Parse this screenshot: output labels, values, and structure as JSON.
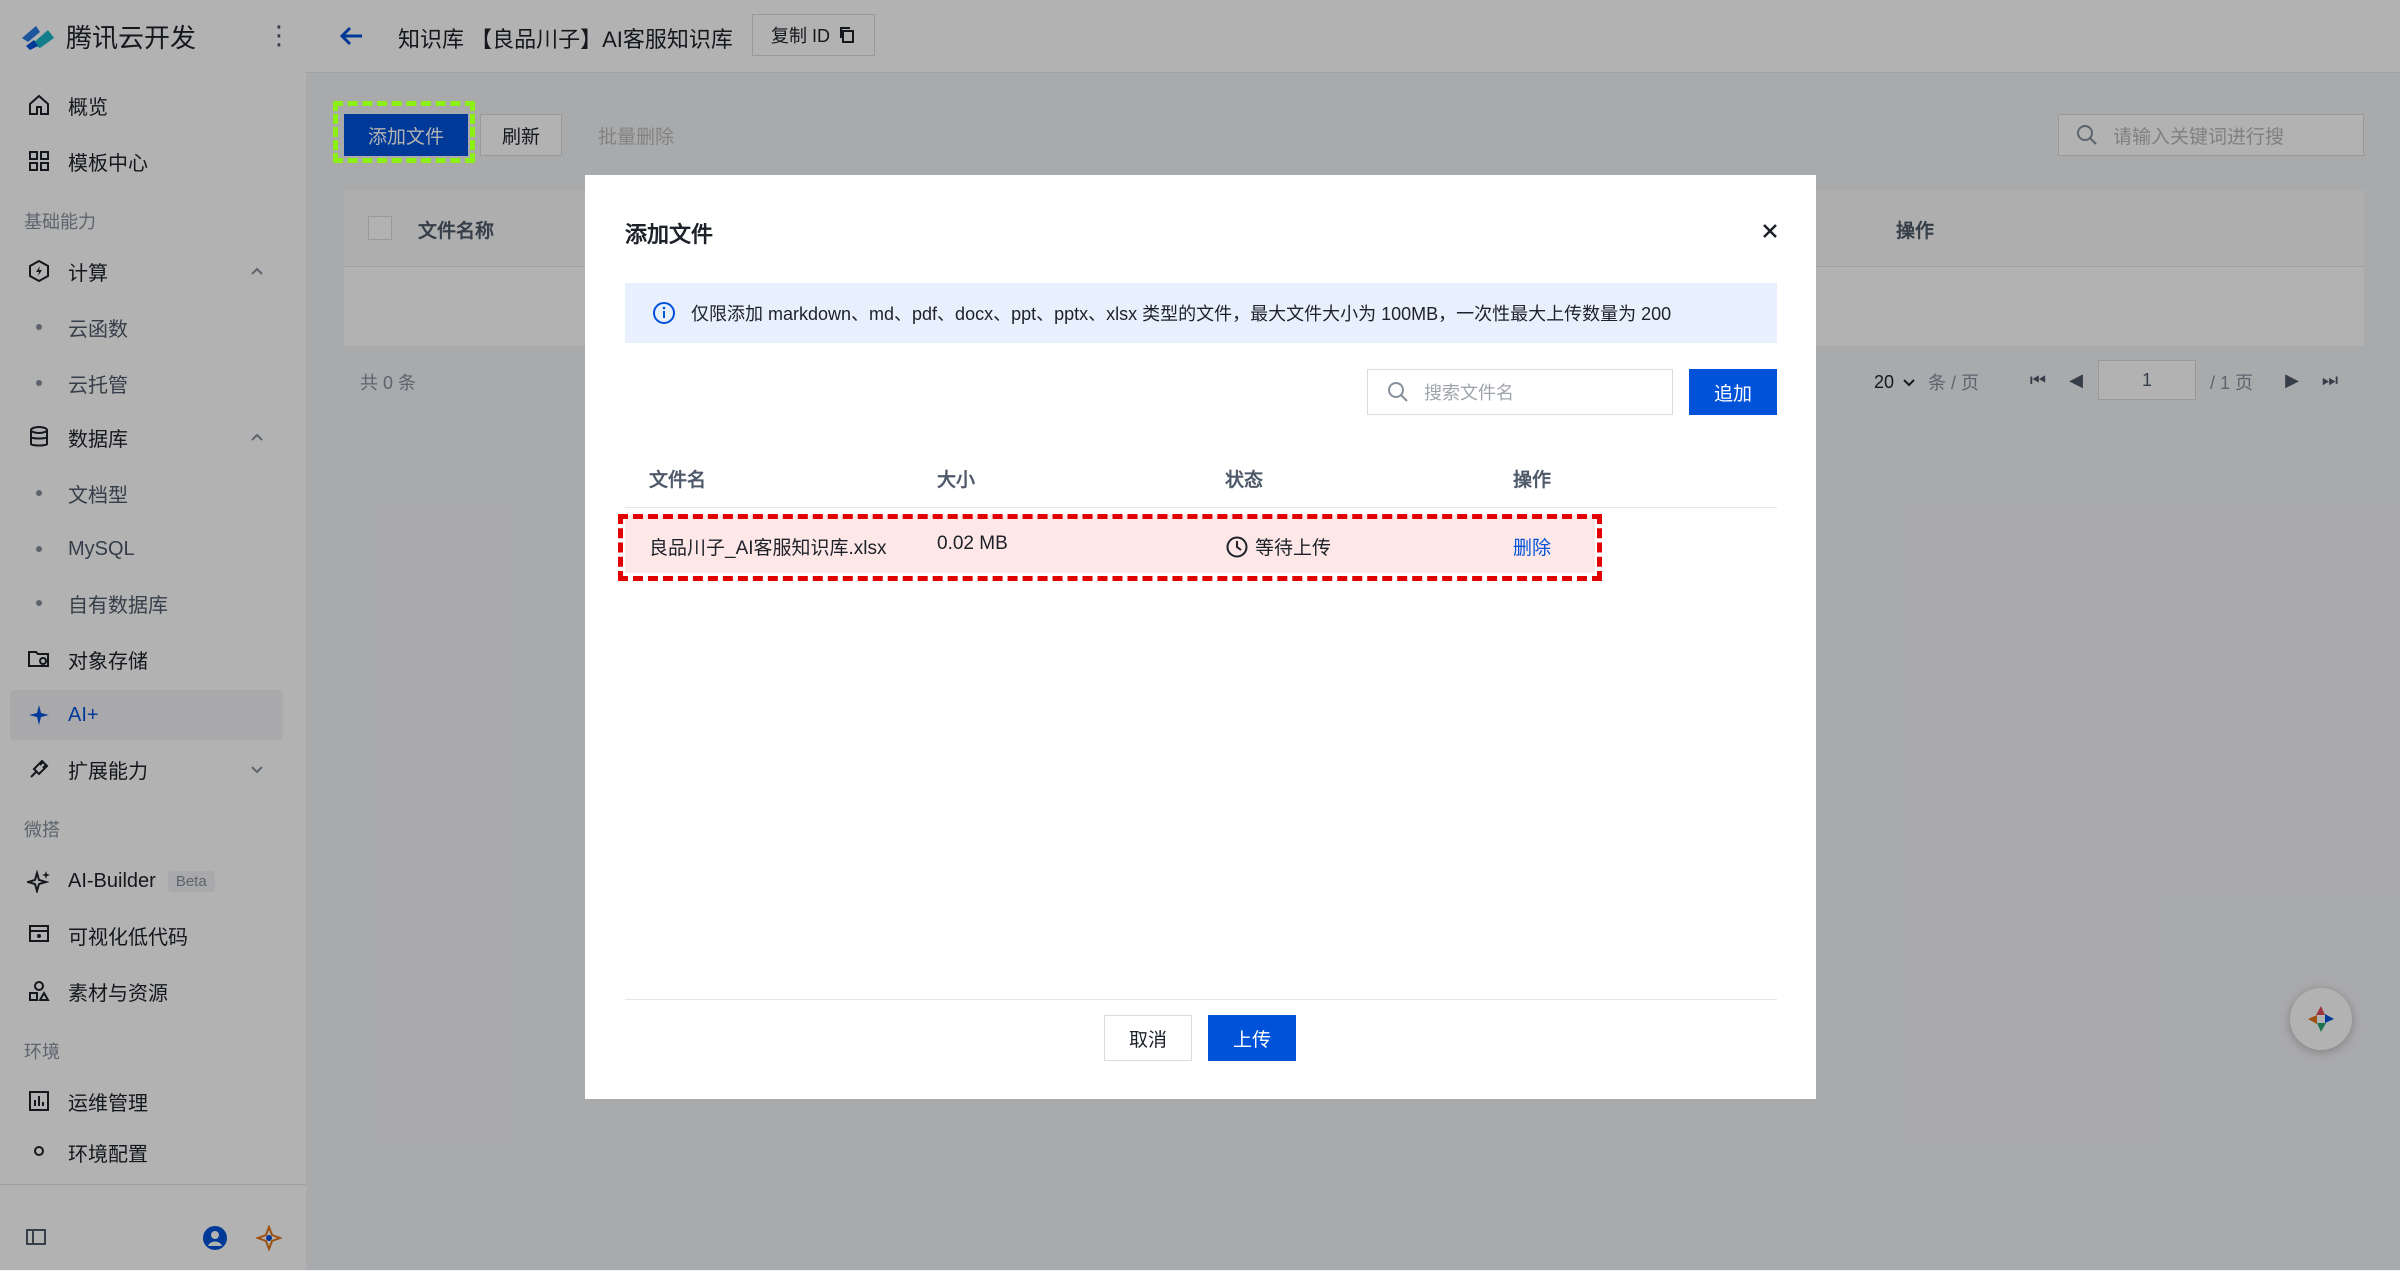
{
  "sidebar": {
    "brand": "腾讯云开发",
    "items": {
      "overview": "概览",
      "templates": "模板中心",
      "group_basic": "基础能力",
      "compute": "计算",
      "cloud_function": "云函数",
      "cloud_hosting": "云托管",
      "database": "数据库",
      "doc_db": "文档型",
      "mysql": "MySQL",
      "own_db": "自有数据库",
      "storage": "对象存储",
      "ai": "AI+",
      "extensions": "扩展能力",
      "group_miniapp": "微搭",
      "ai_builder": "AI-Builder",
      "ai_builder_badge": "Beta",
      "lowcode": "可视化低代码",
      "assets": "素材与资源",
      "group_env": "环境",
      "ops": "运维管理",
      "env_config": "环境配置"
    }
  },
  "header": {
    "breadcrumb": "知识库 【良品川子】AI客服知识库",
    "copy_id": "复制 ID"
  },
  "toolbar": {
    "add_file": "添加文件",
    "refresh": "刷新",
    "batch_delete": "批量删除",
    "search_placeholder": "请输入关键词进行搜"
  },
  "main_table": {
    "col_name": "文件名称",
    "col_action": "操作"
  },
  "pagination": {
    "total": "共 0 条",
    "page_size": "20",
    "per_page": "条 / 页",
    "page": "1",
    "total_pages": "/ 1 页"
  },
  "modal": {
    "title": "添加文件",
    "notice": "仅限添加 markdown、md、pdf、docx、ppt、pptx、xlsx 类型的文件，最大文件大小为 100MB，一次性最大上传数量为 200",
    "search_placeholder": "搜索文件名",
    "append": "追加",
    "columns": {
      "name": "文件名",
      "size": "大小",
      "status": "状态",
      "action": "操作"
    },
    "files": [
      {
        "name": "良品川子_AI客服知识库.xlsx",
        "size": "0.02 MB",
        "status": "等待上传",
        "action": "删除"
      }
    ],
    "cancel": "取消",
    "upload": "上传"
  },
  "colors": {
    "primary": "#0052d9",
    "highlight_green": "#8cf015",
    "highlight_red": "#e30000"
  }
}
